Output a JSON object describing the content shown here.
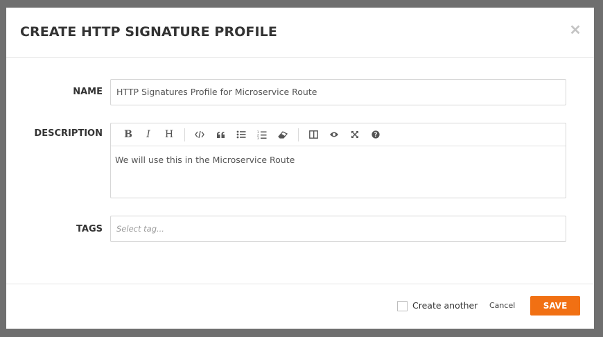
{
  "dialog": {
    "title": "CREATE HTTP SIGNATURE PROFILE",
    "close_icon": "close-icon"
  },
  "form": {
    "name": {
      "label": "NAME",
      "value": "HTTP Signatures Profile for Microservice Route"
    },
    "description": {
      "label": "DESCRIPTION",
      "value": "We will use this in the Microservice Route",
      "toolbar": [
        "bold-icon",
        "italic-icon",
        "heading-icon",
        "code-icon",
        "quote-icon",
        "unordered-list-icon",
        "ordered-list-icon",
        "eraser-icon",
        "side-by-side-icon",
        "preview-icon",
        "fullscreen-icon",
        "help-icon"
      ],
      "toolbar_glyphs": {
        "bold": "B",
        "italic": "I",
        "heading": "H"
      }
    },
    "tags": {
      "label": "TAGS",
      "placeholder": "Select tag..."
    }
  },
  "footer": {
    "create_another_label": "Create another",
    "create_another_checked": false,
    "cancel_label": "Cancel",
    "save_label": "SAVE"
  },
  "colors": {
    "accent": "#f17013",
    "overlay": "#6f6f6f",
    "text": "#333333"
  }
}
